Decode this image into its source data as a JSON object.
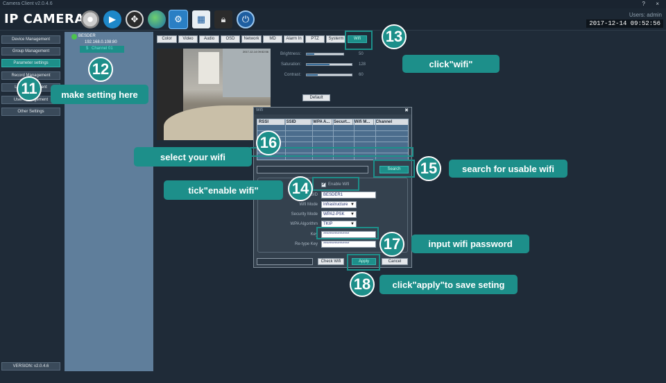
{
  "window": {
    "title": "Camera Client v2.0.4.6",
    "help": "?",
    "close": "×"
  },
  "header": {
    "brand": "IP CAMERA",
    "users": "Users: admin",
    "clock": "2017-12-14  09:52:56"
  },
  "toolbar_icons": [
    "camera-icon",
    "playback-icon",
    "ptz-icon",
    "globe-icon",
    "settings-icon",
    "record-file-icon",
    "lock-icon",
    "power-icon"
  ],
  "nav": {
    "items": [
      "Device Management",
      "Group Management",
      "Parameter settings",
      "Record Management",
      "Log Management",
      "User Management",
      "Other Settings"
    ],
    "version": "VERSION: v2.0.4.6"
  },
  "tree": {
    "root": "BESDER",
    "ip": "192.168.0.108:80",
    "channel": "Channel 01"
  },
  "tabs": [
    "Color",
    "Video",
    "Audio",
    "OSD",
    "Network",
    "MD",
    "Alarm In",
    "PTZ",
    "Systerm",
    "Wifi"
  ],
  "video": {
    "timestamp": "2017-12-14 09:52:56"
  },
  "color": {
    "brightness_label": "Brightness:",
    "brightness": 50,
    "saturation_label": "Saturation:",
    "saturation": 128,
    "contrast_label": "Contrast:",
    "contrast": 60,
    "default_label": "Default"
  },
  "wifi": {
    "title": "Wifi",
    "columns": [
      "RSSI",
      "SSID",
      "WPA A...",
      "Securt...",
      "Wifi M...",
      "Channel"
    ],
    "search_label": "Search",
    "enable_label": "Enable Wifi",
    "ssid_label": "SSID",
    "ssid": "BESDER1",
    "mode_label": "Wifi Mode",
    "mode": "Infrastructure",
    "security_label": "Security Mode",
    "security": "WPA2-PSK",
    "algo_label": "WPA Algorithm",
    "algo": "TKIP",
    "key_label": "Key",
    "key": "****************",
    "retype_label": "Re-type Key",
    "retype": "****************",
    "check_label": "Check Wifi",
    "apply_label": "Apply",
    "cancel_label": "Cancel"
  },
  "annotations": {
    "n11": "11",
    "n12": "12",
    "n13": "13",
    "n14": "14",
    "n15": "15",
    "n16": "16",
    "n17": "17",
    "n18": "18",
    "t11": "make setting here",
    "t13": "click\"wifi\"",
    "t14": "tick\"enable wifi\"",
    "t15": "search for usable wifi",
    "t16": "select your wifi",
    "t17": "input wifi password",
    "t18": "click\"apply\"to save seting"
  },
  "colors": {
    "accent": "#1d8f8a",
    "panel": "#1f2b38",
    "tree": "#5f7e9b"
  }
}
